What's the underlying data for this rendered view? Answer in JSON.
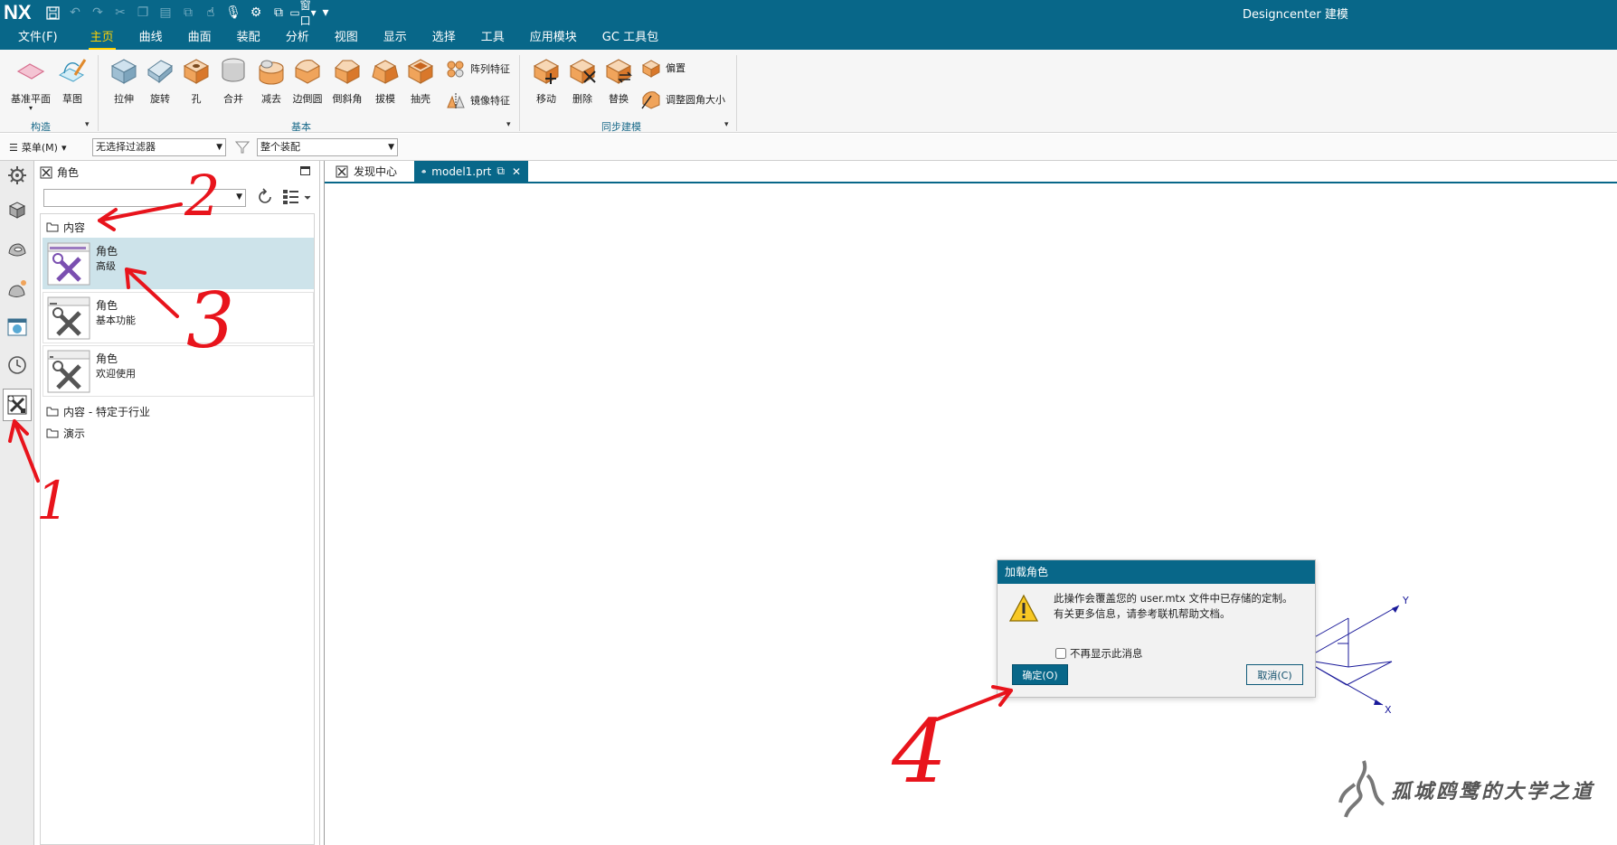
{
  "app": {
    "logo": "NX",
    "title": "Designcenter 建模",
    "window_label": "窗口"
  },
  "menu_tabs": [
    {
      "label": "文件(F)"
    },
    {
      "label": "主页"
    },
    {
      "label": "曲线"
    },
    {
      "label": "曲面"
    },
    {
      "label": "装配"
    },
    {
      "label": "分析"
    },
    {
      "label": "视图"
    },
    {
      "label": "显示"
    },
    {
      "label": "选择"
    },
    {
      "label": "工具"
    },
    {
      "label": "应用模块"
    },
    {
      "label": "GC 工具包"
    }
  ],
  "ribbon": {
    "construct": {
      "label": "构造",
      "items": [
        "基准平面",
        "草图"
      ]
    },
    "basic": {
      "label": "基本",
      "items": [
        "拉伸",
        "旋转",
        "孔",
        "合并",
        "减去",
        "边倒圆",
        "倒斜角",
        "拔模",
        "抽壳"
      ],
      "small_items": [
        "阵列特征",
        "镜像特征"
      ]
    },
    "sync": {
      "label": "同步建模",
      "items": [
        "移动",
        "删除",
        "替换"
      ],
      "small_items": [
        "偏置",
        "调整圆角大小"
      ]
    }
  },
  "filterbar": {
    "menu_label": "菜单(M)",
    "filter_value": "无选择过滤器",
    "scope_value": "整个装配"
  },
  "role_panel": {
    "title": "角色",
    "folders": {
      "content": "内容",
      "industry": "内容 - 特定于行业",
      "demo": "演示"
    },
    "roles": [
      {
        "name": "角色",
        "desc": "高级"
      },
      {
        "name": "角色",
        "desc": "基本功能"
      },
      {
        "name": "角色",
        "desc": "欢迎使用"
      }
    ]
  },
  "doc_tabs": [
    {
      "label": "发现中心"
    },
    {
      "label": "model1.prt"
    }
  ],
  "dialog": {
    "title": "加载角色",
    "message_line1": "此操作会覆盖您的 user.mtx 文件中已存储的定制。",
    "message_line2": "有关更多信息，请参考联机帮助文档。",
    "checkbox_label": "不再显示此消息",
    "ok_label": "确定(O)",
    "cancel_label": "取消(C)"
  },
  "axes": {
    "y": "Y",
    "x": "X"
  },
  "annotations": [
    "1",
    "2",
    "3",
    "4"
  ],
  "watermark": "孤城鸥鹭的大学之道",
  "colors": {
    "brand": "#086789",
    "active_tab": "#ffd200",
    "selected_row": "#cde3ea",
    "annotation_red": "#e8141c"
  }
}
